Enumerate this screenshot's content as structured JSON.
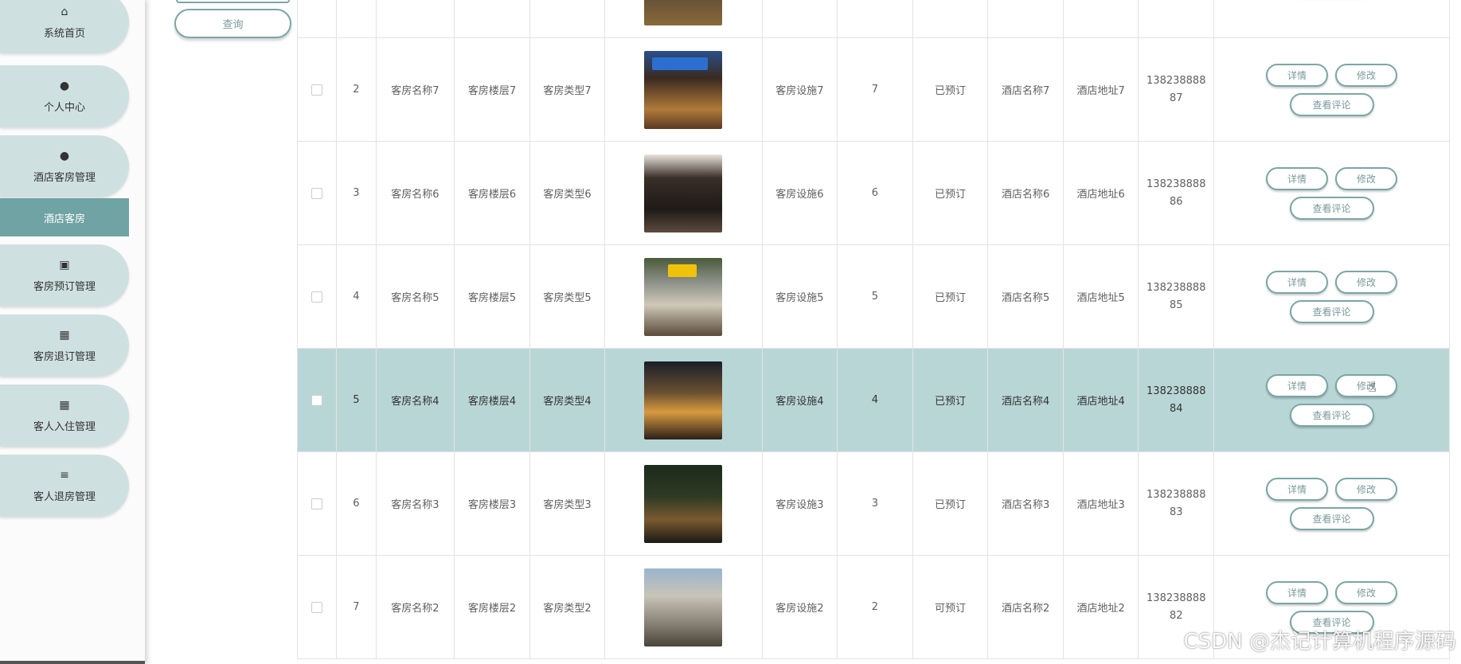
{
  "sidebar": {
    "items": [
      {
        "label": "系统首页",
        "icon": "home-icon"
      },
      {
        "label": "个人中心",
        "icon": "person-icon"
      },
      {
        "label": "酒店客房管理",
        "icon": "person-badge-icon"
      },
      {
        "label": "客房预订管理",
        "icon": "briefcase-icon"
      },
      {
        "label": "客房退订管理",
        "icon": "grid-icon"
      },
      {
        "label": "客人入住管理",
        "icon": "grid-icon"
      },
      {
        "label": "客人退房管理",
        "icon": "sliders-icon"
      }
    ],
    "active_sub": "酒店客房"
  },
  "search": {
    "query_label": "查询"
  },
  "table": {
    "rows": [
      {
        "idx": "2",
        "name": "客房名称7",
        "floor": "客房楼层7",
        "type": "客房类型7",
        "facility": "客房设施7",
        "price": "7",
        "status": "已预订",
        "hotel": "酒店名称7",
        "address": "酒店地址7",
        "phone_a": "138238888",
        "phone_b": "87"
      },
      {
        "idx": "3",
        "name": "客房名称6",
        "floor": "客房楼层6",
        "type": "客房类型6",
        "facility": "客房设施6",
        "price": "6",
        "status": "已预订",
        "hotel": "酒店名称6",
        "address": "酒店地址6",
        "phone_a": "138238888",
        "phone_b": "86"
      },
      {
        "idx": "4",
        "name": "客房名称5",
        "floor": "客房楼层5",
        "type": "客房类型5",
        "facility": "客房设施5",
        "price": "5",
        "status": "已预订",
        "hotel": "酒店名称5",
        "address": "酒店地址5",
        "phone_a": "138238888",
        "phone_b": "85"
      },
      {
        "idx": "5",
        "name": "客房名称4",
        "floor": "客房楼层4",
        "type": "客房类型4",
        "facility": "客房设施4",
        "price": "4",
        "status": "已预订",
        "hotel": "酒店名称4",
        "address": "酒店地址4",
        "phone_a": "138238888",
        "phone_b": "84"
      },
      {
        "idx": "6",
        "name": "客房名称3",
        "floor": "客房楼层3",
        "type": "客房类型3",
        "facility": "客房设施3",
        "price": "3",
        "status": "已预订",
        "hotel": "酒店名称3",
        "address": "酒店地址3",
        "phone_a": "138238888",
        "phone_b": "83"
      },
      {
        "idx": "7",
        "name": "客房名称2",
        "floor": "客房楼层2",
        "type": "客房类型2",
        "facility": "客房设施2",
        "price": "2",
        "status": "可预订",
        "hotel": "酒店名称2",
        "address": "酒店地址2",
        "phone_a": "138238888",
        "phone_b": "82"
      }
    ],
    "actions": {
      "detail": "详情",
      "edit": "修改",
      "reviews": "查看评论"
    }
  },
  "watermark": "CSDN @杰记计算机程序源码",
  "colors": {
    "accent": "#6fa3a4",
    "menu_bg": "#cfe0e0",
    "highlight_row": "#b9d6d7",
    "button_border": "#7aa6a6"
  }
}
